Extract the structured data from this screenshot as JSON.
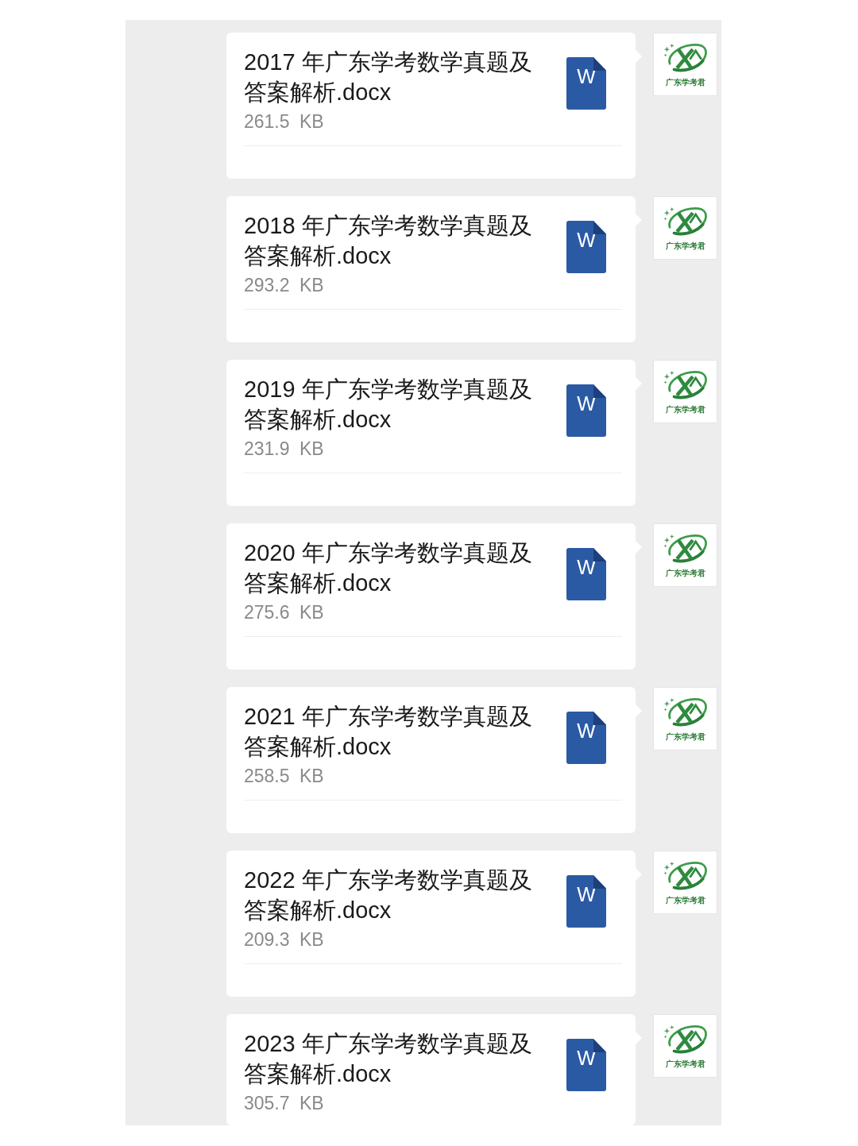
{
  "chat": {
    "messages": [
      {
        "file": {
          "name": "2017 年广东学考数学真题及答案解析.docx",
          "size": "261.5 KB",
          "icon_letter": "W"
        },
        "avatar": {
          "caption": "广东学考君"
        }
      },
      {
        "file": {
          "name": "2018 年广东学考数学真题及答案解析.docx",
          "size": "293.2 KB",
          "icon_letter": "W"
        },
        "avatar": {
          "caption": "广东学考君"
        }
      },
      {
        "file": {
          "name": "2019 年广东学考数学真题及答案解析.docx",
          "size": "231.9 KB",
          "icon_letter": "W"
        },
        "avatar": {
          "caption": "广东学考君"
        }
      },
      {
        "file": {
          "name": "2020 年广东学考数学真题及答案解析.docx",
          "size": "275.6 KB",
          "icon_letter": "W"
        },
        "avatar": {
          "caption": "广东学考君"
        }
      },
      {
        "file": {
          "name": "2021 年广东学考数学真题及答案解析.docx",
          "size": "258.5 KB",
          "icon_letter": "W"
        },
        "avatar": {
          "caption": "广东学考君"
        }
      },
      {
        "file": {
          "name": "2022 年广东学考数学真题及答案解析.docx",
          "size": "209.3 KB",
          "icon_letter": "W"
        },
        "avatar": {
          "caption": "广东学考君"
        }
      },
      {
        "file": {
          "name": "2023 年广东学考数学真题及答案解析.docx",
          "size": "305.7 KB",
          "icon_letter": "W"
        },
        "avatar": {
          "caption": "广东学考君"
        }
      }
    ]
  }
}
